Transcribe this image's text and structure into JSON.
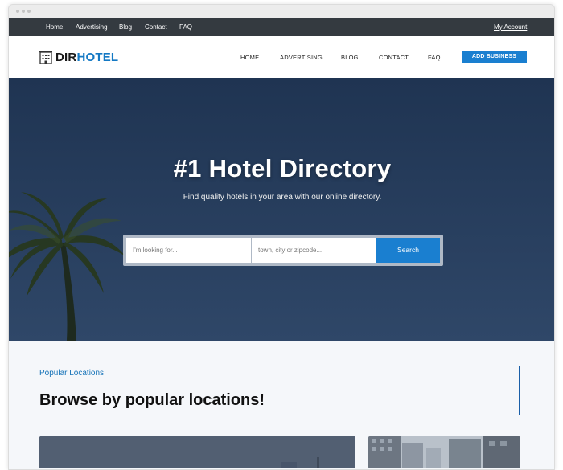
{
  "colors": {
    "accent": "#1a7fd0",
    "topbar": "#343a40",
    "hero": "#263d5d",
    "section_bg": "#f5f7fa"
  },
  "topbar": {
    "links": [
      "Home",
      "Advertising",
      "Blog",
      "Contact",
      "FAQ"
    ],
    "account": "My Account"
  },
  "header": {
    "logo": {
      "part1": "DIR",
      "part2": "HOTEL",
      "icon": "hotel-building-icon"
    },
    "nav": [
      "HOME",
      "ADVERTISING",
      "BLOG",
      "CONTACT",
      "FAQ"
    ],
    "cta": "ADD BUSINESS"
  },
  "hero": {
    "title": "#1 Hotel Directory",
    "subtitle": "Find quality hotels in your area with our online directory.",
    "search": {
      "what_placeholder": "I'm looking for...",
      "where_placeholder": "town, city or zipcode...",
      "button": "Search"
    }
  },
  "popular": {
    "label": "Popular Locations",
    "title": "Browse by popular locations!"
  }
}
